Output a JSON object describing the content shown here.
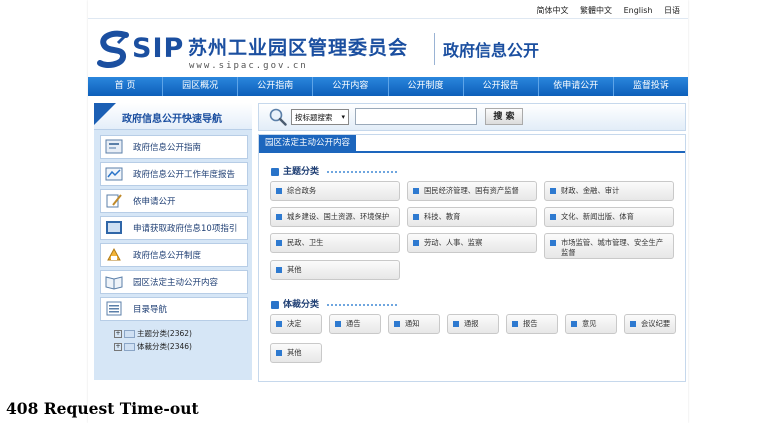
{
  "lang_bar": [
    "简体中文",
    "繁體中文",
    "English",
    "日语"
  ],
  "header": {
    "logo_text": "SIP",
    "title": "苏州工业园区管理委员会",
    "domain": "www.sipac.gov.cn",
    "subtitle": "政府信息公开"
  },
  "nav": [
    "首  页",
    "园区概况",
    "公开指南",
    "公开内容",
    "公开制度",
    "公开报告",
    "依申请公开",
    "监督投诉"
  ],
  "sidebar": {
    "title": "政府信息公开快速导航",
    "items": [
      {
        "label": "政府信息公开指南",
        "icon": "guide-icon"
      },
      {
        "label": "政府信息公开工作年度报告",
        "icon": "report-icon"
      },
      {
        "label": "依申请公开",
        "icon": "application-icon"
      },
      {
        "label": "申请获取政府信息10项指引",
        "icon": "instructions-icon"
      },
      {
        "label": "政府信息公开制度",
        "icon": "system-icon"
      },
      {
        "label": "园区法定主动公开内容",
        "icon": "disclosure-icon"
      },
      {
        "label": "目录导航",
        "icon": "catalog-icon"
      }
    ],
    "tree": [
      {
        "label": "主题分类(2362)"
      },
      {
        "label": "体裁分类(2346)"
      }
    ]
  },
  "search": {
    "select_value": "按标题搜索",
    "input_value": "",
    "button_label": "搜 索"
  },
  "content": {
    "tab": "园区法定主动公开内容",
    "theme_heading": "主题分类",
    "themes": [
      "综合政务",
      "国民经济管理、国有资产监督",
      "财政、金融、审计",
      "城乡建设、国土资源、环境保护",
      "科技、教育",
      "文化、新闻出版、体育",
      "民政、卫生",
      "劳动、人事、监察",
      "市场监管、城市管理、安全生产监督",
      "其他"
    ],
    "genre_heading": "体裁分类",
    "genres": [
      "决定",
      "通告",
      "通知",
      "通报",
      "报告",
      "意见",
      "会议纪要",
      "其他"
    ]
  },
  "error_message": "408 Request Time-out",
  "colors": {
    "brand_blue": "#1b4fa0",
    "nav_blue": "#1d66bd",
    "panel_bg": "#d6e6f6"
  }
}
